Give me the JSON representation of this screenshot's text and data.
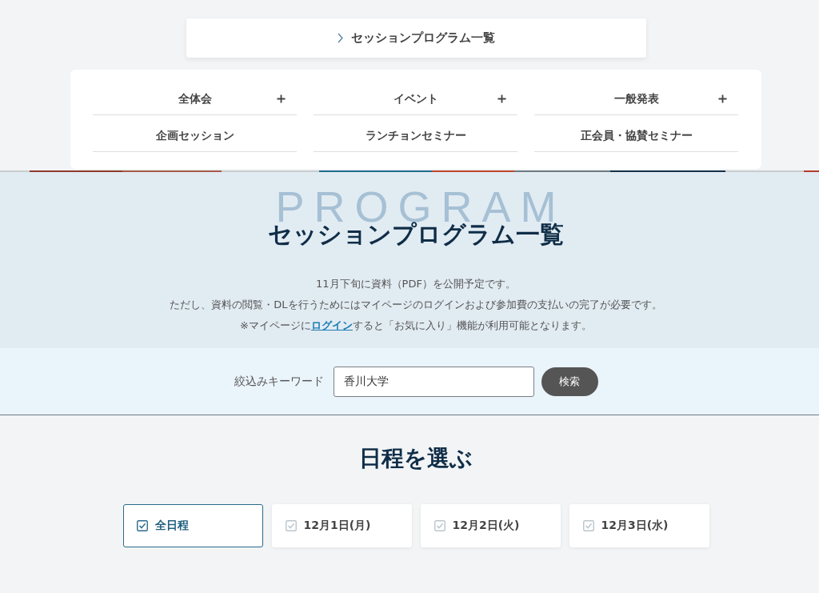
{
  "breadcrumb": {
    "label": "セッションプログラム一覧"
  },
  "nav": {
    "items": [
      {
        "label": "全体会",
        "expandable": true
      },
      {
        "label": "イベント",
        "expandable": true
      },
      {
        "label": "一般発表",
        "expandable": true
      },
      {
        "label": "企画セッション",
        "expandable": false
      },
      {
        "label": "ランチョンセミナー",
        "expandable": false
      },
      {
        "label": "正会員・協賛セミナー",
        "expandable": false
      }
    ]
  },
  "hero": {
    "background_word": "PROGRAM",
    "title": "セッションプログラム一覧",
    "notes": [
      "11月下旬に資料（PDF）を公開予定です。",
      "ただし、資料の閲覧・DLを行うためにはマイページのログインおよび参加費の支払いの完了が必要です。"
    ],
    "login_note": {
      "before": "※マイページに",
      "link": "ログイン",
      "after": "すると「お気に入り」機能が利用可能となります。"
    }
  },
  "search": {
    "label": "絞込みキーワード",
    "value": "香川大学",
    "button": "検索"
  },
  "schedule": {
    "title": "日程を選ぶ",
    "days": [
      {
        "label": "全日程",
        "selected": true
      },
      {
        "label": "12月1日(月)",
        "selected": false
      },
      {
        "label": "12月2日(火)",
        "selected": false
      },
      {
        "label": "12月3日(水)",
        "selected": false
      }
    ]
  }
}
